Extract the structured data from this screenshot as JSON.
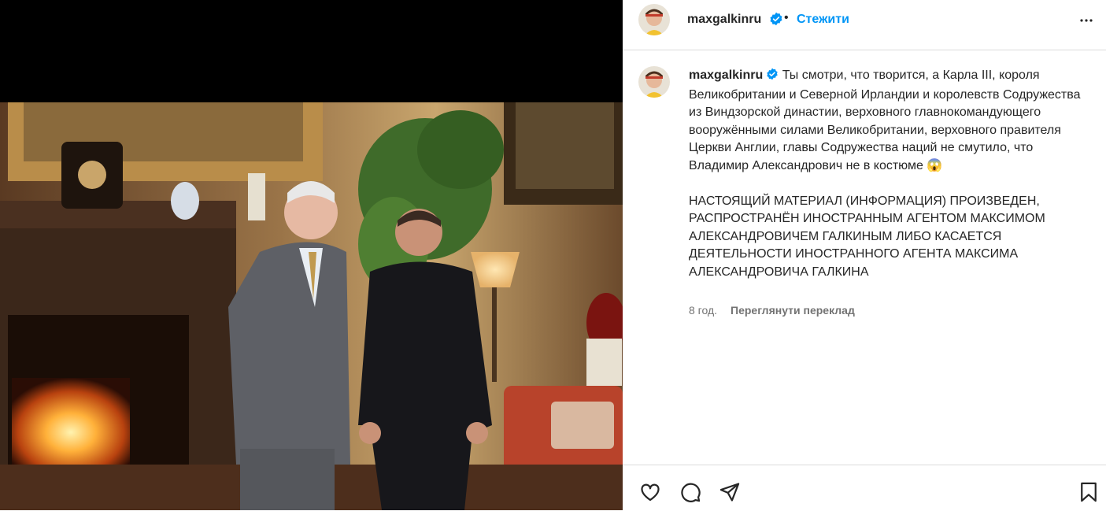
{
  "post": {
    "username": "maxgalkinru",
    "follow_label": "Стежити",
    "separator": "•",
    "caption": "Ты смотри, что творится, а Карла III, короля Великобритании и Северной Ирландии и королевств Содружества из Виндзорской династии, верховного главнокомандующего вооружёнными силами Великобритании, верховного правителя Церкви Англии, главы Содружества наций не смутило, что Владимир Александрович не в костюме 😱",
    "notice": "НАСТОЯЩИЙ МАТЕРИАЛ (ИНФОРМАЦИЯ) ПРОИЗВЕДЕН, РАСПРОСТРАНЁН ИНОСТРАННЫМ АГЕНТОМ МАКСИМОМ АЛЕКСАНДРОВИЧЕМ ГАЛКИНЫМ ЛИБО КАСАЕТСЯ ДЕЯТЕЛЬНОСТИ ИНОСТРАННОГО АГЕНТА МАКСИМА АЛЕКСАНДРОВИЧА ГАЛКИНА",
    "time": "8 год.",
    "translate_label": "Переглянути переклад"
  },
  "icons": {
    "more": "more-horizontal-icon",
    "verified": "verified-badge-icon",
    "like": "heart-icon",
    "comment": "comment-icon",
    "share": "send-icon",
    "save": "bookmark-icon"
  },
  "colors": {
    "link": "#0095f6",
    "verified": "#0095f6",
    "secondary_text": "#737373",
    "divider": "#dbdbdb"
  }
}
